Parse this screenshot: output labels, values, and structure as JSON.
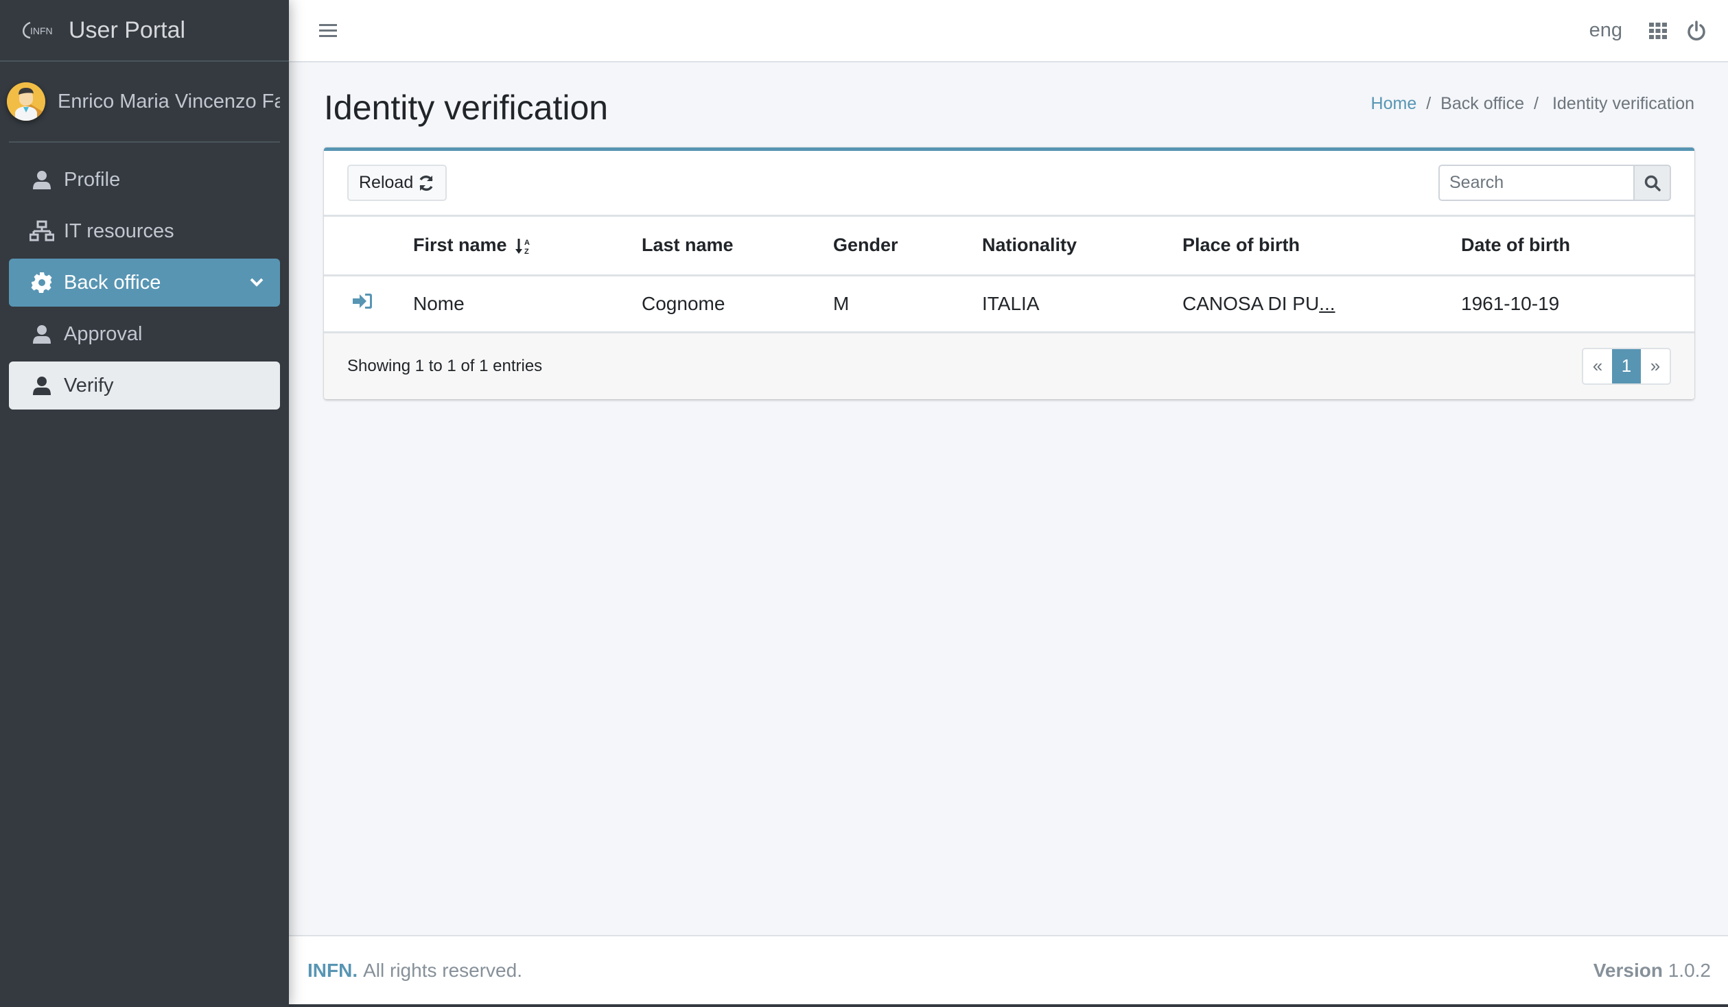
{
  "app": {
    "title": "User Portal",
    "logo_text": "INFN"
  },
  "user": {
    "name": "Enrico Maria Vincenzo Fa"
  },
  "sidebar": {
    "items": [
      {
        "label": "Profile",
        "icon": "user-icon"
      },
      {
        "label": "IT resources",
        "icon": "sitemap-icon"
      },
      {
        "label": "Back office",
        "icon": "gear-icon",
        "state": "expanded"
      },
      {
        "label": "Approval",
        "icon": "user-icon"
      },
      {
        "label": "Verify",
        "icon": "user-icon",
        "state": "selected"
      }
    ]
  },
  "topbar": {
    "language": "eng",
    "apps_icon": "grid-icon",
    "logout_icon": "power-icon"
  },
  "header": {
    "title": "Identity verification",
    "breadcrumb": [
      "Home",
      "Back office",
      "Identity verification"
    ]
  },
  "toolbar": {
    "reload_label": "Reload",
    "search_placeholder": "Search"
  },
  "table": {
    "columns": [
      "",
      "First name",
      "Last name",
      "Gender",
      "Nationality",
      "Place of birth",
      "Date of birth"
    ],
    "sorted_column": "First name",
    "rows": [
      {
        "first_name": "Nome",
        "last_name": "Cognome",
        "gender": "M",
        "nationality": "ITALIA",
        "place_of_birth": "CANOSA DI PU",
        "place_ellipsis": "...",
        "date_of_birth": "1961-10-19"
      }
    ]
  },
  "pagination": {
    "info": "Showing 1 to 1 of 1 entries",
    "prev": "«",
    "current": "1",
    "next": "»"
  },
  "footer": {
    "brand": "INFN.",
    "rights": "All rights reserved.",
    "version_label": "Version",
    "version": "1.0.2"
  },
  "colors": {
    "accent": "#5895b3",
    "sidebar_bg": "#343a40",
    "content_bg": "#f4f6f9"
  }
}
